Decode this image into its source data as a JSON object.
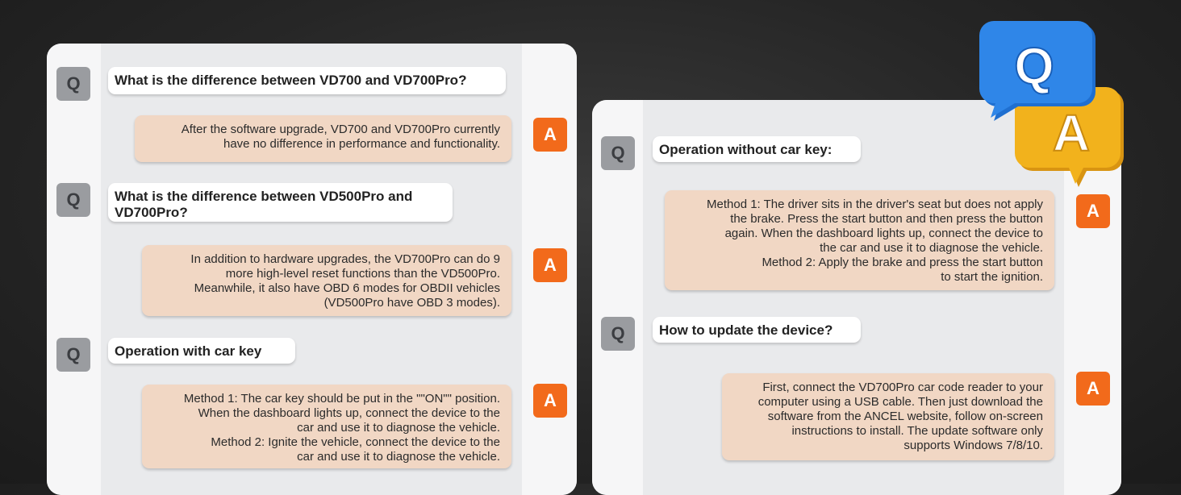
{
  "left_panel": {
    "items": [
      {
        "q_badge": "Q",
        "question": "What is the difference between VD700 and VD700Pro?",
        "a_badge": "A",
        "answer": "After the software upgrade, VD700 and VD700Pro currently\nhave no difference in performance and functionality."
      },
      {
        "q_badge": "Q",
        "question": "What is the difference between VD500Pro and VD700Pro?",
        "a_badge": "A",
        "answer": "In addition to hardware upgrades, the VD700Pro can do 9\nmore high-level reset functions than the VD500Pro.\nMeanwhile, it also have OBD 6 modes for OBDII vehicles\n(VD500Pro have OBD 3 modes)."
      },
      {
        "q_badge": "Q",
        "question": "Operation with car key",
        "a_badge": "A",
        "answer": "Method 1: The car key should be put in the \"\"ON\"\" position.\nWhen the dashboard lights up, connect the device to the\ncar and use it to diagnose the vehicle. \nMethod 2: Ignite the vehicle, connect the device to the\ncar and use it to diagnose the vehicle."
      }
    ]
  },
  "right_panel": {
    "items": [
      {
        "q_badge": "Q",
        "question": "Operation without car key:",
        "a_badge": "A",
        "answer": "Method 1: The driver sits in the driver's seat but does not apply\nthe brake. Press the start button and then press the button\nagain. When the dashboard lights up, connect the device to\nthe car and use it to diagnose the vehicle.\nMethod 2: Apply the brake and press the start button\nto start the ignition."
      },
      {
        "q_badge": "Q",
        "question": "How to update the device?",
        "a_badge": "A",
        "answer": "First, connect the VD700Pro car code reader to your\ncomputer using a USB cable. Then just download the\nsoftware from the ANCEL website, follow on-screen\ninstructions to install. The update software only\nsupports Windows 7/8/10."
      }
    ]
  },
  "logo": {
    "q": "Q",
    "a": "A"
  },
  "colors": {
    "accent": "#f26a1b",
    "answer_bg": "#f1d7c4",
    "q_badge": "#9a9ca0",
    "logo_blue": "#2f86e8",
    "logo_yellow": "#f2b21c"
  }
}
